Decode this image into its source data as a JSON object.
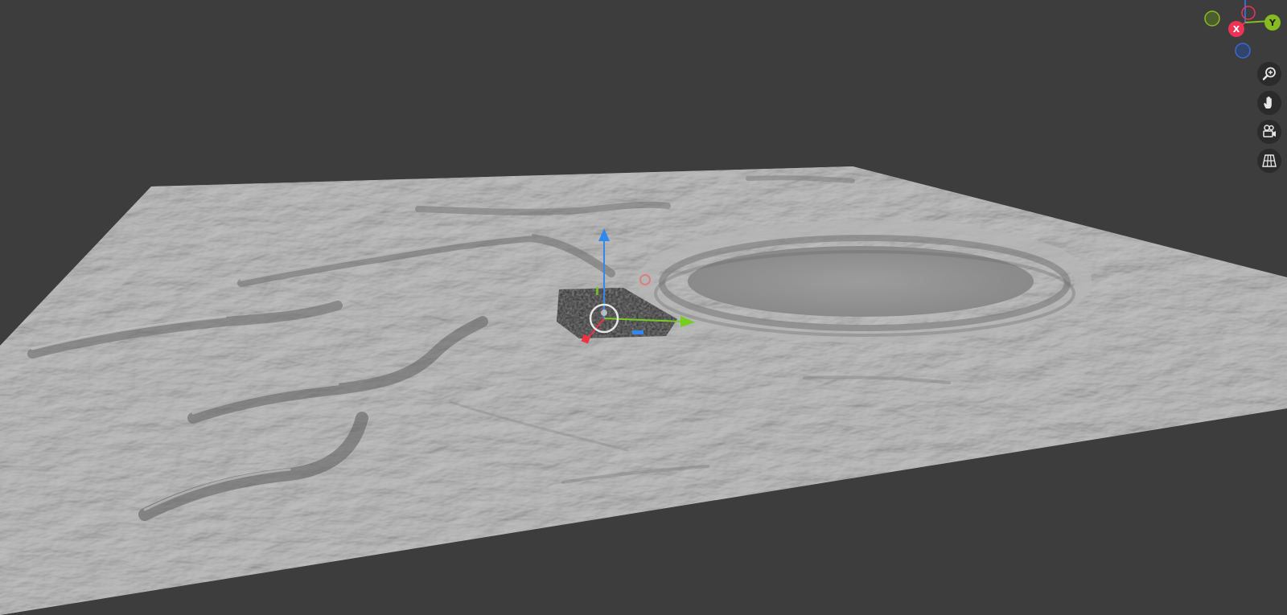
{
  "viewport": {
    "background_color": "#3d3d3d",
    "terrain_color": "#9a9a9a"
  },
  "navigation_gizmo": {
    "axes": [
      {
        "label": "X",
        "color": "#ee3355"
      },
      {
        "label": "Y",
        "color": "#88bb22"
      }
    ],
    "negative_axis_colors": {
      "x": "#ee3355",
      "y": "#7a9a2a",
      "z": "#3a6ad0"
    }
  },
  "navigation_tools": [
    {
      "name": "zoom-icon"
    },
    {
      "name": "hand-pan-icon"
    },
    {
      "name": "camera-view-icon"
    },
    {
      "name": "orthographic-grid-icon"
    }
  ],
  "transform_gizmo": {
    "x_color": "#ee3344",
    "y_color": "#77cc22",
    "z_color": "#3388ee"
  }
}
